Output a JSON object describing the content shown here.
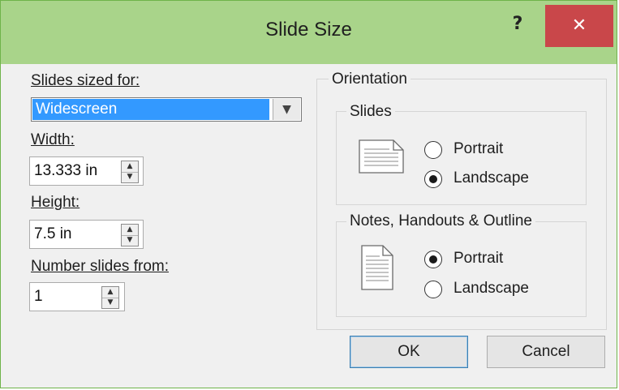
{
  "dialog": {
    "title": "Slide Size",
    "help_label": "?",
    "close_label": "✕"
  },
  "size": {
    "sized_for_label": "Slides sized for:",
    "sized_for_value": "Widescreen",
    "width_label": "Width:",
    "width_value": "13.333 in",
    "height_label": "Height:",
    "height_value": "7.5 in",
    "number_from_label": "Number slides from:",
    "number_from_value": "1"
  },
  "orientation": {
    "title": "Orientation",
    "slides": {
      "title": "Slides",
      "portrait_label": "Portrait",
      "landscape_label": "Landscape",
      "selected": "Landscape"
    },
    "notes": {
      "title": "Notes, Handouts & Outline",
      "portrait_label": "Portrait",
      "landscape_label": "Landscape",
      "selected": "Portrait"
    }
  },
  "buttons": {
    "ok_label": "OK",
    "cancel_label": "Cancel"
  }
}
